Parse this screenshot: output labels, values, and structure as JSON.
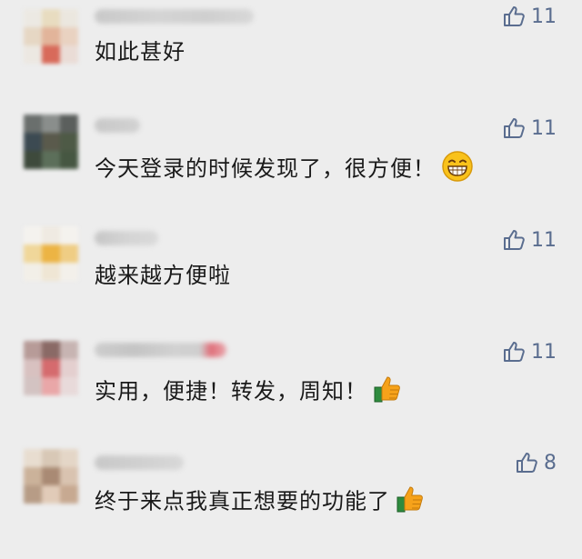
{
  "comments": [
    {
      "text": "如此甚好",
      "likes": "11",
      "emoji": ""
    },
    {
      "text": "今天登录的时候发现了，很方便！",
      "likes": "11",
      "emoji": "grin-emoji"
    },
    {
      "text": "越来越方便啦",
      "likes": "11",
      "emoji": ""
    },
    {
      "text": "实用，便捷！转发，周知！",
      "likes": "11",
      "emoji": "thumbs-up-emoji"
    },
    {
      "text": "终于来点我真正想要的功能了",
      "likes": "8",
      "emoji": "thumbs-up-emoji"
    }
  ],
  "icons": {
    "like": "thumb-up-outline-icon"
  },
  "colors": {
    "background": "#ededed",
    "like": "#5a6d8f",
    "text": "#1a1a1a"
  }
}
